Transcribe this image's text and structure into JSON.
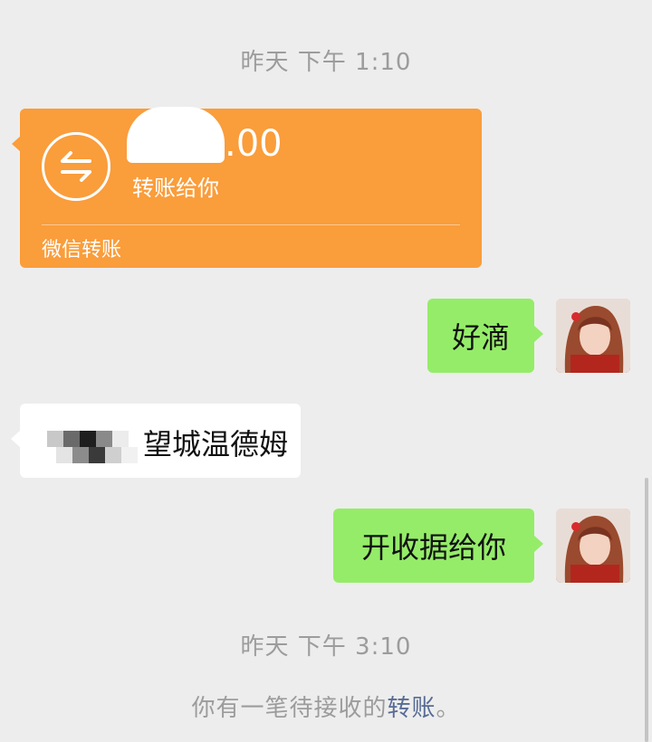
{
  "chat": {
    "timestamp_1": "昨天 下午 1:10",
    "transfer": {
      "amount": ".00",
      "note": "转账给你",
      "footer": "微信转账",
      "icon": "transfer-arrows-icon",
      "color": "#fa9d3b"
    },
    "messages": [
      {
        "side": "right",
        "text": "好滴"
      },
      {
        "side": "left",
        "text": "望城温德姆"
      },
      {
        "side": "right",
        "text": "开收据给你"
      }
    ],
    "timestamp_2": "昨天 下午 3:10",
    "system_notice": {
      "prefix": "你有一笔待接收的",
      "link": "转账",
      "suffix": "。"
    }
  },
  "colors": {
    "background": "#ededed",
    "sent_bubble": "#95ec69",
    "received_bubble": "#ffffff",
    "link": "#576b95"
  }
}
